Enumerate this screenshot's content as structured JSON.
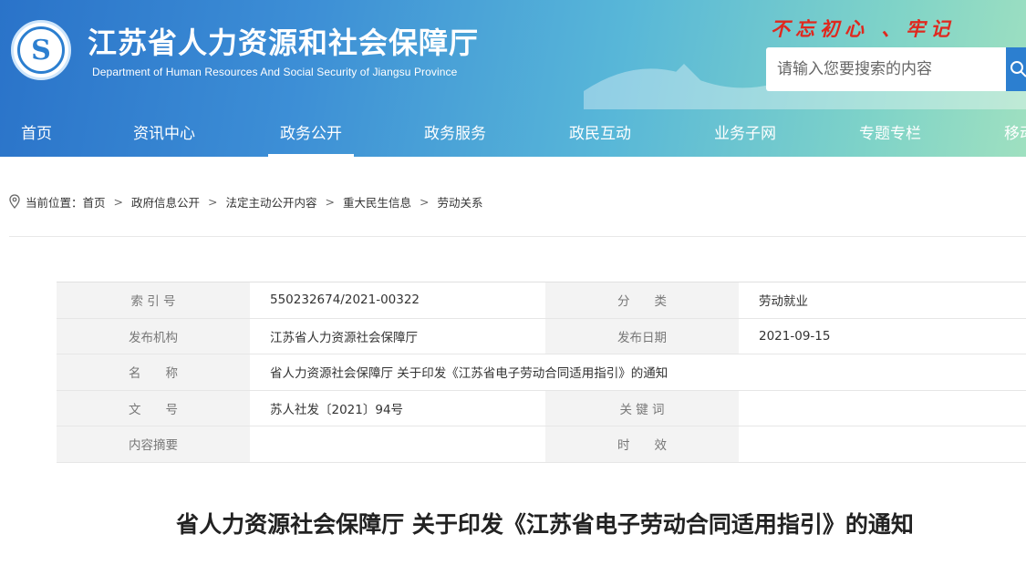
{
  "header": {
    "title": "江苏省人力资源和社会保障厅",
    "subtitle": "Department of Human Resources And Social Security of Jiangsu Province",
    "slogan": "不忘初心 、牢记",
    "logo_icon": "ministry-logo",
    "colors": {
      "gradient_start": "#2a73c9",
      "gradient_end": "#9fe0c0",
      "slogan": "#e0281e"
    }
  },
  "search": {
    "placeholder": "请输入您要搜索的内容",
    "button_icon": "search-icon"
  },
  "nav": {
    "items": [
      {
        "label": "首页"
      },
      {
        "label": "资讯中心"
      },
      {
        "label": "政务公开",
        "active": true
      },
      {
        "label": "政务服务"
      },
      {
        "label": "政民互动"
      },
      {
        "label": "业务子网"
      },
      {
        "label": "专题专栏"
      },
      {
        "label": "移动"
      }
    ]
  },
  "breadcrumb": {
    "icon": "location-pin-icon",
    "prefix": "当前位置：",
    "items": [
      "首页",
      "政府信息公开",
      "法定主动公开内容",
      "重大民生信息",
      "劳动关系"
    ],
    "separator": ">"
  },
  "info_table": {
    "index_label": "索 引 号",
    "index_value": "550232674/2021-00322",
    "category_label": "分　　类",
    "category_value": "劳动就业",
    "publisher_label": "发布机构",
    "publisher_value": "江苏省人力资源社会保障厅",
    "date_label": "发布日期",
    "date_value": "2021-09-15",
    "name_label": "名　　称",
    "name_value": "省人力资源社会保障厅 关于印发《江苏省电子劳动合同适用指引》的通知",
    "doc_no_label": "文　　号",
    "doc_no_value": "苏人社发〔2021〕94号",
    "keywords_label": "关 键 词",
    "keywords_value": "",
    "summary_label": "内容摘要",
    "summary_value": "",
    "validity_label": "时　　效",
    "validity_value": ""
  },
  "document": {
    "title": "省人力资源社会保障厅 关于印发《江苏省电子劳动合同适用指引》的通知"
  }
}
